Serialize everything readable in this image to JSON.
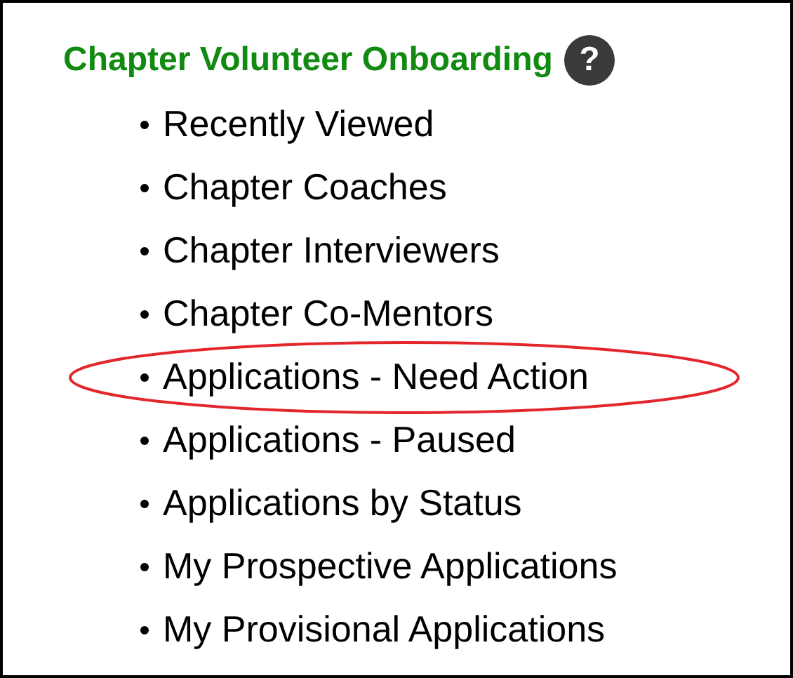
{
  "title": "Chapter Volunteer Onboarding",
  "help": "?",
  "items": [
    {
      "label": "Recently Viewed",
      "highlighted": false
    },
    {
      "label": "Chapter Coaches",
      "highlighted": false
    },
    {
      "label": "Chapter Interviewers",
      "highlighted": false
    },
    {
      "label": "Chapter Co-Mentors",
      "highlighted": false
    },
    {
      "label": "Applications - Need Action",
      "highlighted": true
    },
    {
      "label": "Applications - Paused",
      "highlighted": false
    },
    {
      "label": "Applications by Status",
      "highlighted": false
    },
    {
      "label": "My Prospective Applications",
      "highlighted": false
    },
    {
      "label": "My Provisional Applications",
      "highlighted": false
    }
  ]
}
